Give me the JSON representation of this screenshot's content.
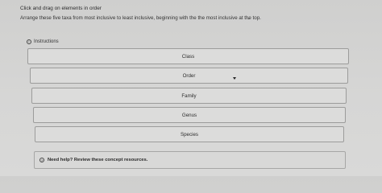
{
  "header": {
    "title": "Click and drag on elements in order"
  },
  "prompt": {
    "text": "Arrange these five taxa from most inclusive to least inclusive, beginning with the the most inclusive at the top."
  },
  "instructions": {
    "icon": "info-icon",
    "icon_glyph": "i",
    "label": "Instructions"
  },
  "order_items": [
    {
      "label": "Class"
    },
    {
      "label": "Order"
    },
    {
      "label": "Family"
    },
    {
      "label": "Genus"
    },
    {
      "label": "Species"
    }
  ],
  "help": {
    "icon": "question-icon",
    "icon_glyph": "?",
    "text": "Need help? Review these concept resources."
  }
}
